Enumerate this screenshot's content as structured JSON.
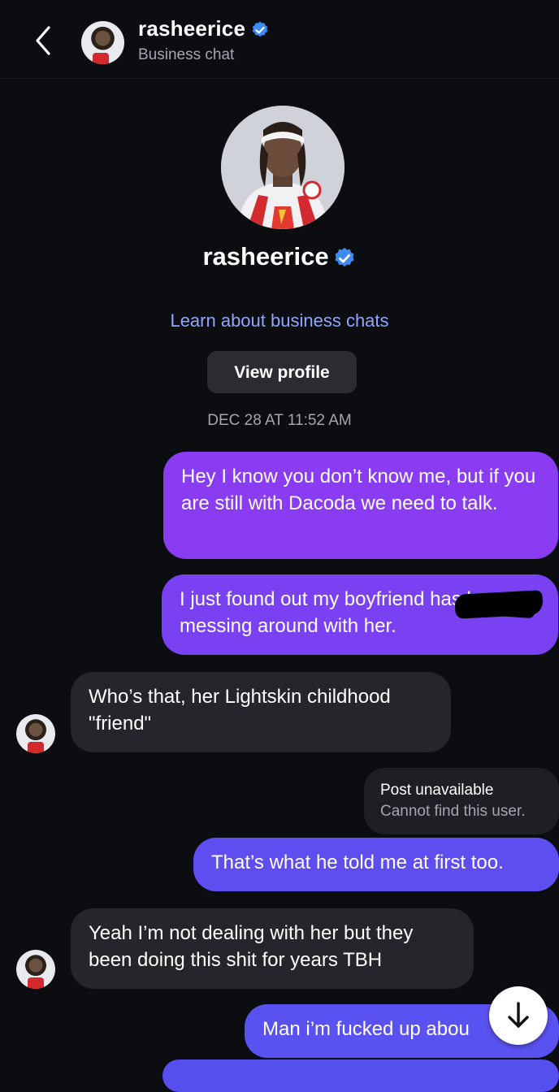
{
  "header": {
    "username": "rasheerice",
    "subtitle": "Business chat",
    "back_icon": "chevron-left-icon",
    "verified_icon": "verified-badge-icon"
  },
  "profile": {
    "username": "rasheerice",
    "learn_link": "Learn about business chats",
    "view_profile_label": "View profile"
  },
  "thread": {
    "timestamp": "DEC 28 AT 11:52 AM",
    "messages": [
      {
        "from": "me",
        "text": "Hey I know you don’t know me, but if you are still with Dacoda we need to talk."
      },
      {
        "from": "me",
        "text": "I just found out my boyfriend        has been messing around with her."
      },
      {
        "from": "them",
        "text": "Who’s that, her Lightskin childhood \"friend\""
      },
      {
        "from": "me",
        "text": "That’s what he told me at first too."
      },
      {
        "from": "them",
        "text": "Yeah I’m not dealing with her but they been doing this shit for years TBH"
      },
      {
        "from": "me",
        "text": "Man i’m fucked up abou"
      }
    ],
    "post_unavailable": {
      "title": "Post unavailable",
      "subtitle": "Cannot find this user."
    }
  },
  "colors": {
    "background": "#0c0d11",
    "outgoing_bubble": "#7b3ff0",
    "incoming_bubble": "#25262c",
    "link": "#8ea6ff",
    "verified": "#3d8af7"
  },
  "scroll_down_icon": "arrow-down-icon"
}
